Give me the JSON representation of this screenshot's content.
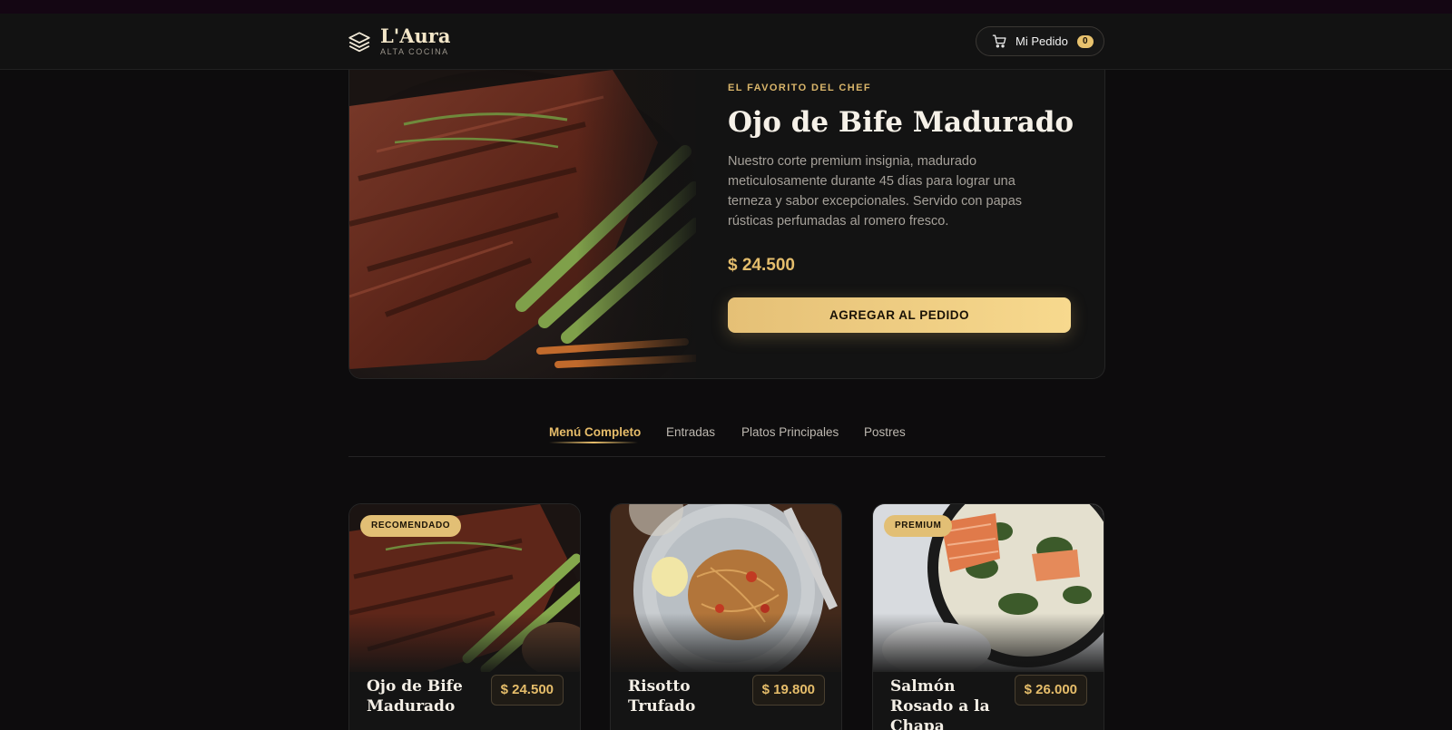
{
  "brand": {
    "name": "L'Aura",
    "tagline": "ALTA COCINA"
  },
  "cart": {
    "label": "Mi Pedido",
    "count": "0"
  },
  "hero": {
    "eyebrow": "EL FAVORITO DEL CHEF",
    "title": "Ojo de Bife Madurado",
    "description": "Nuestro corte premium insignia, madurado meticulosamente durante 45 días para lograr una terneza y sabor excepcionales. Servido con papas rústicas perfumadas al romero fresco.",
    "price": "$ 24.500",
    "cta": "AGREGAR AL PEDIDO"
  },
  "tabs": [
    {
      "label": "Menú Completo",
      "active": true
    },
    {
      "label": "Entradas"
    },
    {
      "label": "Platos Principales"
    },
    {
      "label": "Postres"
    }
  ],
  "cards": [
    {
      "badge": "RECOMENDADO",
      "title": "Ojo de Bife Madurado",
      "price": "$ 24.500"
    },
    {
      "badge": "",
      "title": "Risotto Trufado",
      "price": "$ 19.800"
    },
    {
      "badge": "PREMIUM",
      "title": "Salmón Rosado a la Chapa",
      "price": "$ 26.000"
    }
  ],
  "colors": {
    "accent": "#e7bd6a",
    "background": "#0d0c0d",
    "panel": "#131313"
  }
}
